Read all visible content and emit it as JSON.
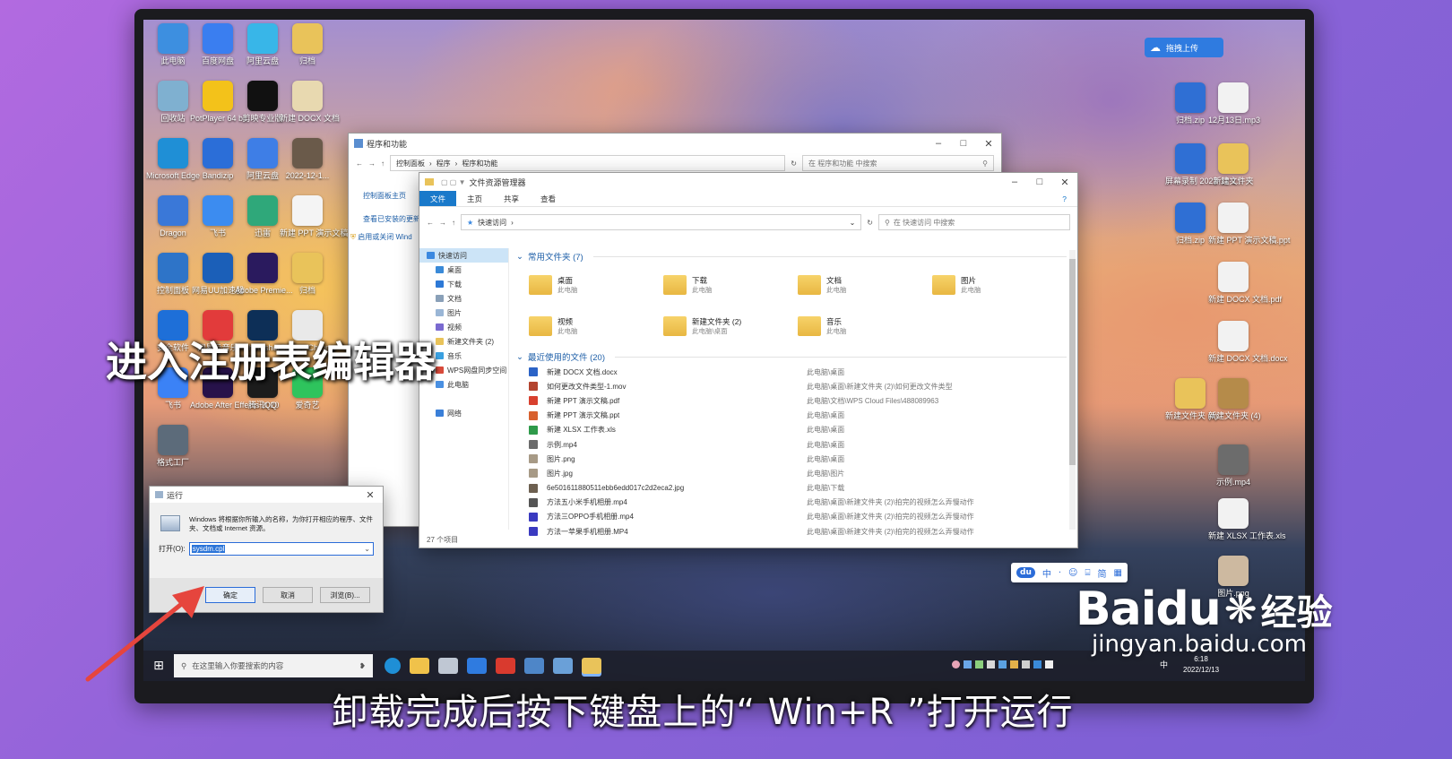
{
  "desktop": {
    "left_icons": [
      {
        "label": "此电脑",
        "color": "#3d8fe0"
      },
      {
        "label": "百度网盘",
        "color": "#3a7ef0"
      },
      {
        "label": "阿里云盘",
        "color": "#38b6e8"
      },
      {
        "label": "归档",
        "color": "#e9c35a"
      },
      {
        "label": "回收站",
        "color": "#7fb0d0"
      },
      {
        "label": "PotPlayer 64 bit",
        "color": "#f3c21a"
      },
      {
        "label": "剪映专业版",
        "color": "#111111"
      },
      {
        "label": "新建 DOCX 文档",
        "color": "#e8d9b0"
      },
      {
        "label": "Microsoft Edge",
        "color": "#1f8fd6"
      },
      {
        "label": "Bandizip",
        "color": "#2b6ed8"
      },
      {
        "label": "阿里云盘",
        "color": "#3e7ee6"
      },
      {
        "label": "2022-12-1...",
        "color": "#6a5a4a"
      },
      {
        "label": "Dragon",
        "color": "#3a78d8"
      },
      {
        "label": "飞书",
        "color": "#3c8cf0"
      },
      {
        "label": "迅雷",
        "color": "#2fa87a"
      },
      {
        "label": "新建 PPT 演示文稿.pdf",
        "color": "#f4f4f4"
      },
      {
        "label": "控制面板",
        "color": "#2e74c8"
      },
      {
        "label": "网易UU加速器",
        "color": "#1b5fb8"
      },
      {
        "label": "Adobe Premie...",
        "color": "#2a1a5e"
      },
      {
        "label": "归档",
        "color": "#e9c35a"
      },
      {
        "label": "安全软件",
        "color": "#1e6fd8"
      },
      {
        "label": "网易云音乐",
        "color": "#e23b3b"
      },
      {
        "label": "Photoshop",
        "color": "#0d2f57"
      },
      {
        "label": "Google Chrome",
        "color": "#e9e9e9"
      },
      {
        "label": "飞书",
        "color": "#3b82f6"
      },
      {
        "label": "Adobe After Effects 2020",
        "color": "#27124a"
      },
      {
        "label": "腾讯QQ",
        "color": "#1c1c1c"
      },
      {
        "label": "爱奇艺",
        "color": "#2ec45d"
      },
      {
        "label": "格式工厂",
        "color": "#5c6b7a"
      }
    ],
    "right_icons": [
      {
        "label": "归档.zip",
        "color": "#2f6fd4"
      },
      {
        "label": "12月13日.mp3",
        "color": "#f2f2f2"
      },
      {
        "label": "屏幕录制 2022-12-1...",
        "color": "#2f6fd4"
      },
      {
        "label": "新建文件夹",
        "color": "#e9c35a"
      },
      {
        "label": "归档.zip",
        "color": "#2f6fd4"
      },
      {
        "label": "新建 PPT 演示文稿.ppt",
        "color": "#f2f2f2"
      },
      {
        "label": "新建 DOCX 文档.pdf",
        "color": "#f2f2f2"
      },
      {
        "label": "新建 DOCX 文档.docx",
        "color": "#f2f2f2"
      },
      {
        "label": "新建文件夹 (4)",
        "color": "#e9c35a"
      },
      {
        "label": "新建文件夹 (4)",
        "color": "#b58b4a"
      },
      {
        "label": "示例.mp4",
        "color": "#6c6c6c"
      },
      {
        "label": "新建 XLSX 工作表.xls",
        "color": "#f2f2f2"
      },
      {
        "label": "图片.png",
        "color": "#cdb9a0"
      }
    ],
    "upload_button": "拖拽上传"
  },
  "control_panel": {
    "title": "程序和功能",
    "path": [
      "控制面板",
      "程序",
      "程序和功能"
    ],
    "search_placeholder": "在 程序和功能 中搜索",
    "sidebar": [
      "控制面板主页",
      "查看已安装的更新",
      "启用或关闭 Wind"
    ]
  },
  "explorer": {
    "title": "文件资源管理器",
    "ribbon_tabs": [
      "文件",
      "主页",
      "共享",
      "查看"
    ],
    "path": "快速访问",
    "search_placeholder": "在 快速访问 中搜索",
    "tree": [
      {
        "label": "快速访问",
        "color": "#3a88e0"
      },
      {
        "label": "桌面",
        "color": "#3a8ad8"
      },
      {
        "label": "下载",
        "color": "#2d79d6"
      },
      {
        "label": "文档",
        "color": "#8aa0b8"
      },
      {
        "label": "图片",
        "color": "#9ab6d6"
      },
      {
        "label": "视频",
        "color": "#7a6ad0"
      },
      {
        "label": "新建文件夹 (2)",
        "color": "#e9c35a"
      },
      {
        "label": "音乐",
        "color": "#3aa0e0"
      },
      {
        "label": "WPS网盘同步空间",
        "color": "#d84a3a"
      },
      {
        "label": "此电脑",
        "color": "#4a90e2"
      },
      {
        "label": "",
        "color": "transparent"
      },
      {
        "label": "网络",
        "color": "#3a7fd8"
      }
    ],
    "frequent_header": "常用文件夹 (7)",
    "folders": [
      {
        "name": "桌面",
        "sub": "此电脑"
      },
      {
        "name": "下载",
        "sub": "此电脑"
      },
      {
        "name": "文档",
        "sub": "此电脑"
      },
      {
        "name": "图片",
        "sub": "此电脑"
      },
      {
        "name": "视频",
        "sub": "此电脑"
      },
      {
        "name": "新建文件夹 (2)",
        "sub": "此电脑\\桌面"
      },
      {
        "name": "音乐",
        "sub": "此电脑"
      }
    ],
    "recent_header": "最近使用的文件 (20)",
    "recent": [
      {
        "name": "新建 DOCX 文档.docx",
        "path": "此电脑\\桌面",
        "color": "#2b63c6"
      },
      {
        "name": "如何更改文件类型-1.mov",
        "path": "此电脑\\桌面\\新建文件夹 (2)\\如何更改文件类型",
        "color": "#b3432e"
      },
      {
        "name": "新建 PPT 演示文稿.pdf",
        "path": "此电脑\\文档\\WPS Cloud Files\\488089963",
        "color": "#d8402e"
      },
      {
        "name": "新建 PPT 演示文稿.ppt",
        "path": "此电脑\\桌面",
        "color": "#d8602e"
      },
      {
        "name": "新建 XLSX 工作表.xls",
        "path": "此电脑\\桌面",
        "color": "#2e9a4a"
      },
      {
        "name": "示例.mp4",
        "path": "此电脑\\桌面",
        "color": "#6b6b6b"
      },
      {
        "name": "图片.png",
        "path": "此电脑\\桌面",
        "color": "#a79a86"
      },
      {
        "name": "图片.jpg",
        "path": "此电脑\\图片",
        "color": "#a79a86"
      },
      {
        "name": "6e501611880511ebb6edd017c2d2eca2.jpg",
        "path": "此电脑\\下载",
        "color": "#6d6050"
      },
      {
        "name": "方法五小米手机相册.mp4",
        "path": "此电脑\\桌面\\新建文件夹 (2)\\拍完的视频怎么弄慢动作",
        "color": "#555555"
      },
      {
        "name": "方法三OPPO手机相册.mp4",
        "path": "此电脑\\桌面\\新建文件夹 (2)\\拍完的视频怎么弄慢动作",
        "color": "#3a3ac0"
      },
      {
        "name": "方法一苹果手机相册.MP4",
        "path": "此电脑\\桌面\\新建文件夹 (2)\\拍完的视频怎么弄慢动作",
        "color": "#3a3ac0"
      }
    ],
    "status": "27 个项目"
  },
  "run_dialog": {
    "title": "运行",
    "description": "Windows 将根据你所输入的名称，为你打开相应的程序、文件夹、文档或 Internet 资源。",
    "open_label": "打开(O):",
    "input_value": "sysdm.cpl",
    "ok": "确定",
    "cancel": "取消",
    "browse": "浏览(B)..."
  },
  "taskbar": {
    "search_placeholder": "在这里输入你要搜索的内容",
    "clock_time": "6:18",
    "clock_date": "2022/12/13",
    "ime": "中"
  },
  "ime_bar": {
    "logo": "du",
    "items": [
      "中",
      "·",
      "☺",
      "⌸",
      "简",
      "▦"
    ]
  },
  "overlay_text": "进入注册表编辑器",
  "caption": "卸载完成后按下键盘上的“ Win+R ”打开运行",
  "watermark": {
    "brand": "Baidu",
    "cn": "经验",
    "url": "jingyan.baidu.com"
  }
}
